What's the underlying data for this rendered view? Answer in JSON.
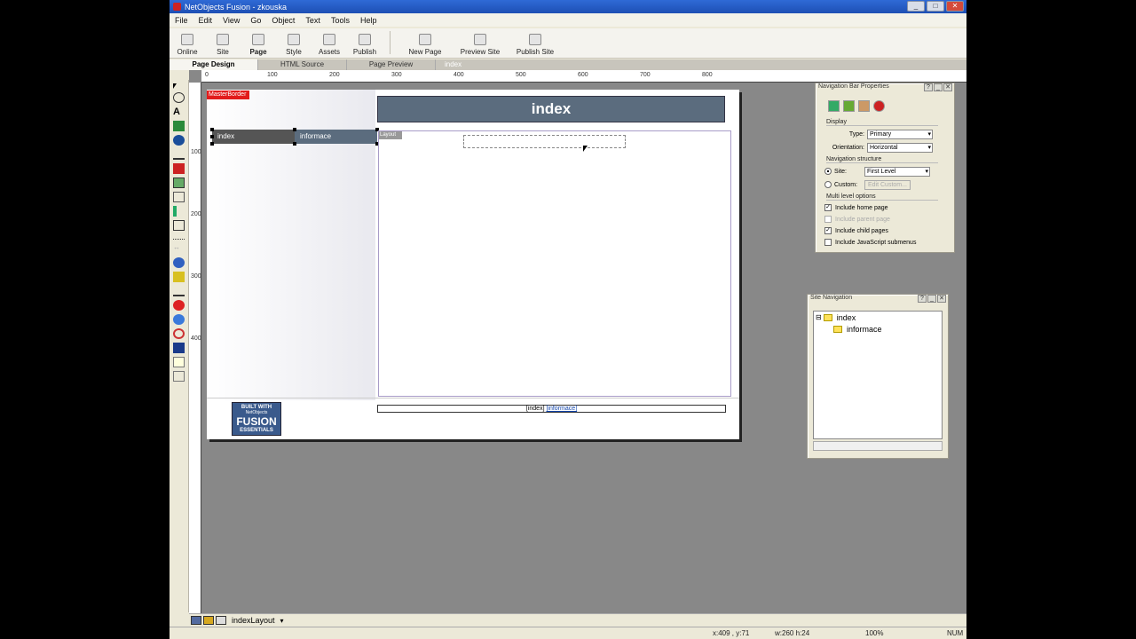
{
  "window": {
    "title": "NetObjects Fusion - zkouska",
    "min": "_",
    "max": "□",
    "close": "✕"
  },
  "menu": [
    "File",
    "Edit",
    "View",
    "Go",
    "Object",
    "Text",
    "Tools",
    "Help"
  ],
  "toolbar": {
    "online": "Online",
    "site": "Site",
    "page": "Page",
    "style": "Style",
    "assets": "Assets",
    "publish": "Publish",
    "new_page": "New Page",
    "preview_site": "Preview Site",
    "publish_site": "Publish Site"
  },
  "view_tabs": {
    "page_design": "Page Design",
    "html_source": "HTML Source",
    "page_preview": "Page Preview",
    "page_name": "index"
  },
  "ruler": {
    "h": [
      "0",
      "100",
      "200",
      "300",
      "400",
      "500",
      "600",
      "700",
      "800"
    ],
    "v": [
      "100",
      "200",
      "300",
      "400"
    ]
  },
  "page": {
    "masterborder": "MasterBorder",
    "banner": "index",
    "nav": [
      "index",
      "informace"
    ],
    "layout_tag": "Layout",
    "badge": {
      "line1": "BUILT WITH",
      "line2": "NetObjects",
      "line3": "FUSION",
      "line4": "ESSENTIALS"
    },
    "textnav": {
      "first": "[index]",
      "second": "[informace]"
    }
  },
  "navprops": {
    "title": "Navigation Bar Properties",
    "display": "Display",
    "type_label": "Type:",
    "type_value": "Primary",
    "orientation_label": "Orientation:",
    "orientation_value": "Horizontal",
    "nav_structure": "Navigation structure",
    "site_label": "Site:",
    "site_value": "First Level",
    "custom_label": "Custom:",
    "edit_custom": "Edit Custom...",
    "multi_level": "Multi level options",
    "opt_home": "Include home page",
    "opt_parent": "Include parent page",
    "opt_child": "Include child pages",
    "opt_js": "Include JavaScript submenus",
    "checked": "✓"
  },
  "sitenav": {
    "title": "Site Navigation",
    "root": "index",
    "child": "informace",
    "expander": "⊟"
  },
  "bottombar": {
    "layout_name": "indexLayout"
  },
  "status": {
    "coords": "x:409 , y:71",
    "size": "w:260 h:24",
    "zoom": "100%",
    "num": "NUM"
  }
}
